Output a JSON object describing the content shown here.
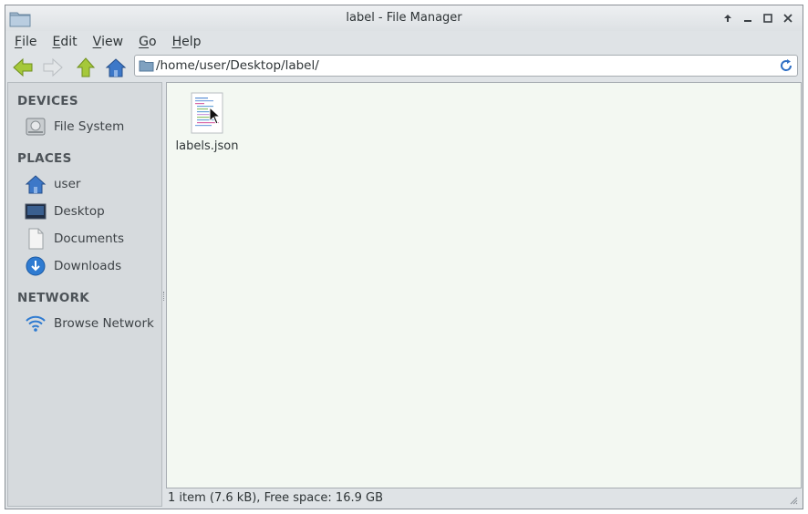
{
  "window": {
    "title": "label - File Manager",
    "controls": {
      "up": "🡡",
      "minimize": "–",
      "maximize": "□",
      "close": "✕"
    }
  },
  "menu": [
    {
      "first": "F",
      "rest": "ile"
    },
    {
      "first": "E",
      "rest": "dit"
    },
    {
      "first": "V",
      "rest": "iew"
    },
    {
      "first": "G",
      "rest": "o"
    },
    {
      "first": "H",
      "rest": "elp"
    }
  ],
  "toolbar": {
    "address": "/home/user/Desktop/label/",
    "icons": [
      "back-icon",
      "forward-icon",
      "up-icon",
      "home-icon",
      "refresh-icon"
    ]
  },
  "sidebar": {
    "devices_header": "DEVICES",
    "places_header": "PLACES",
    "network_header": "NETWORK",
    "devices": [
      {
        "label": "File System",
        "icon": "drive-icon"
      }
    ],
    "places": [
      {
        "label": "user",
        "icon": "home-icon"
      },
      {
        "label": "Desktop",
        "icon": "desktop-icon"
      },
      {
        "label": "Documents",
        "icon": "document-icon"
      },
      {
        "label": "Downloads",
        "icon": "download-icon"
      }
    ],
    "network": [
      {
        "label": "Browse Network",
        "icon": "wifi-icon"
      }
    ]
  },
  "files": [
    {
      "name": "labels.json",
      "icon": "text-file-icon"
    }
  ],
  "status": "1 item (7.6 kB), Free space: 16.9 GB",
  "colors": {
    "content_bg": "#f3f8f2",
    "sidebar_bg": "#d6dadd",
    "accent_blue": "#3a7bd5",
    "nav_green": "#8bc34a"
  }
}
